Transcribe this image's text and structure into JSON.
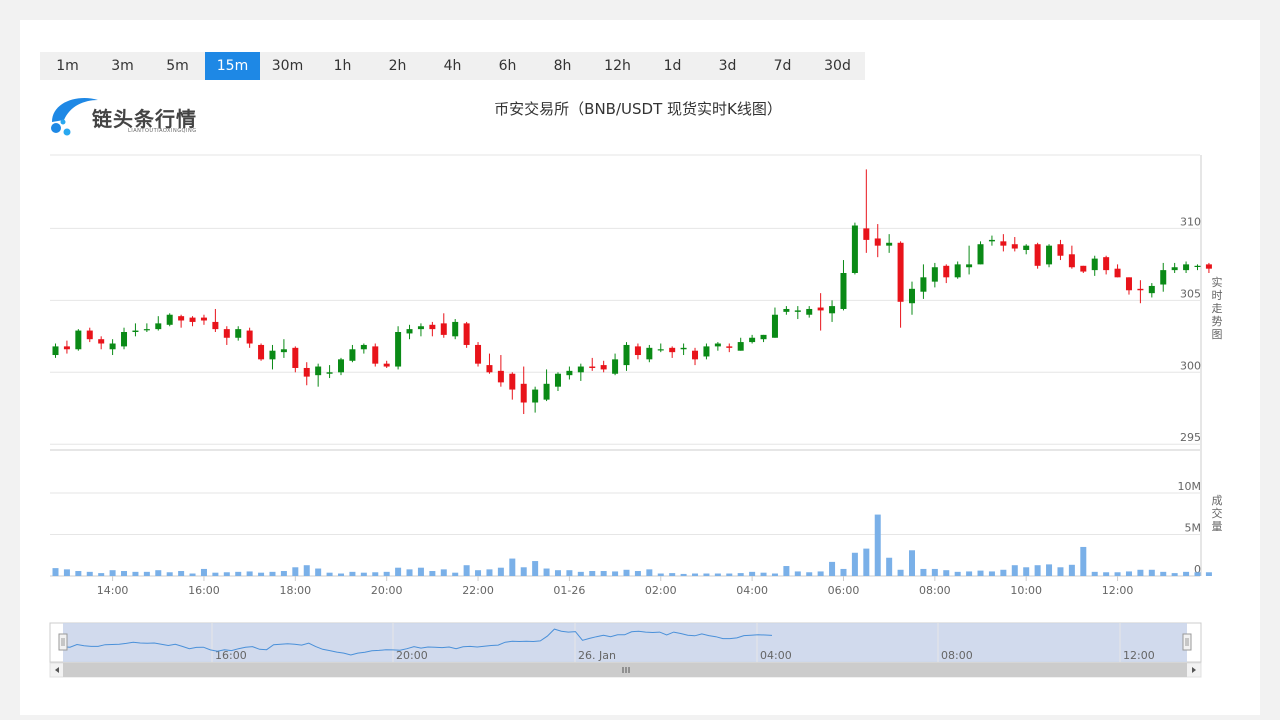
{
  "intervals": [
    "1m",
    "3m",
    "5m",
    "15m",
    "30m",
    "1h",
    "2h",
    "4h",
    "6h",
    "8h",
    "12h",
    "1d",
    "3d",
    "7d",
    "30d"
  ],
  "active_interval": "15m",
  "logo": {
    "text": "链头条行情",
    "subtext": "LIANTOUTIAOXINGQING"
  },
  "colors": {
    "up": "#0a8a16",
    "down": "#e8131a",
    "volume": "#7ab0e8",
    "accent": "#1e88e5"
  },
  "chart_data": {
    "type": "candlestick",
    "title": "币安交易所（BNB/USDT 现货实时K线图）",
    "price_axis": {
      "label": "实时走势图",
      "ticks": [
        295,
        300,
        305,
        310
      ],
      "range": [
        294.6,
        315.1
      ],
      "position": "right"
    },
    "volume_axis": {
      "label": "成交量",
      "ticks": [
        "0",
        "5M",
        "10M"
      ],
      "range": [
        0,
        10
      ],
      "unit": "M",
      "position": "right"
    },
    "x_ticks": [
      "14:00",
      "16:00",
      "18:00",
      "20:00",
      "22:00",
      "01-26",
      "02:00",
      "04:00",
      "06:00",
      "08:00",
      "10:00",
      "12:00"
    ],
    "interval_minutes": 15,
    "candles": [
      [
        301.2,
        301.8,
        302.0,
        301.0
      ],
      [
        301.8,
        301.6,
        302.2,
        301.3
      ],
      [
        301.6,
        302.9,
        303.0,
        301.5
      ],
      [
        302.9,
        302.3,
        303.1,
        302.1
      ],
      [
        302.3,
        302.0,
        302.5,
        301.6
      ],
      [
        301.6,
        302.0,
        302.3,
        301.2
      ],
      [
        301.8,
        302.8,
        303.1,
        301.6
      ],
      [
        302.8,
        302.9,
        303.4,
        302.5
      ],
      [
        303.0,
        303.0,
        303.4,
        302.8
      ],
      [
        303.0,
        303.4,
        303.9,
        302.9
      ],
      [
        303.3,
        304.0,
        304.1,
        303.2
      ],
      [
        303.9,
        303.6,
        304.0,
        303.1
      ],
      [
        303.8,
        303.5,
        303.9,
        303.2
      ],
      [
        303.8,
        303.6,
        304.0,
        303.3
      ],
      [
        303.5,
        303.0,
        304.4,
        302.8
      ],
      [
        303.0,
        302.4,
        303.2,
        301.9
      ],
      [
        302.4,
        303.0,
        303.2,
        302.2
      ],
      [
        302.9,
        302.0,
        303.1,
        301.7
      ],
      [
        301.9,
        300.9,
        302.0,
        300.8
      ],
      [
        300.9,
        301.5,
        301.9,
        300.2
      ],
      [
        301.4,
        301.6,
        302.3,
        301.0
      ],
      [
        301.7,
        300.3,
        301.8,
        300.0
      ],
      [
        300.3,
        299.7,
        300.7,
        299.1
      ],
      [
        299.8,
        300.4,
        300.6,
        299.0
      ],
      [
        299.9,
        300.0,
        300.5,
        299.6
      ],
      [
        300.0,
        300.9,
        301.0,
        299.8
      ],
      [
        300.8,
        301.6,
        301.9,
        300.7
      ],
      [
        301.6,
        301.9,
        302.0,
        301.3
      ],
      [
        301.8,
        300.6,
        302.0,
        300.4
      ],
      [
        300.6,
        300.4,
        300.8,
        300.3
      ],
      [
        300.4,
        302.8,
        303.2,
        300.2
      ],
      [
        302.7,
        303.0,
        303.3,
        302.3
      ],
      [
        303.0,
        303.2,
        303.4,
        302.5
      ],
      [
        303.3,
        303.0,
        303.5,
        302.5
      ],
      [
        303.4,
        302.6,
        304.1,
        302.4
      ],
      [
        302.5,
        303.5,
        303.7,
        302.3
      ],
      [
        303.4,
        301.9,
        303.5,
        301.7
      ],
      [
        301.9,
        300.6,
        302.1,
        300.4
      ],
      [
        300.5,
        300.0,
        301.3,
        299.9
      ],
      [
        300.1,
        299.3,
        301.2,
        299.0
      ],
      [
        299.9,
        298.8,
        300.0,
        298.1
      ],
      [
        299.2,
        297.9,
        300.4,
        297.1
      ],
      [
        297.9,
        298.8,
        299.0,
        297.2
      ],
      [
        298.1,
        299.2,
        300.2,
        298.0
      ],
      [
        299.0,
        299.9,
        300.0,
        298.7
      ],
      [
        299.8,
        300.1,
        300.4,
        299.5
      ],
      [
        300.0,
        300.4,
        300.6,
        299.4
      ],
      [
        300.4,
        300.3,
        301.0,
        300.1
      ],
      [
        300.5,
        300.2,
        300.8,
        300.0
      ],
      [
        299.9,
        300.9,
        301.3,
        299.8
      ],
      [
        300.5,
        301.9,
        302.1,
        300.1
      ],
      [
        301.8,
        301.2,
        302.0,
        300.9
      ],
      [
        300.9,
        301.7,
        301.9,
        300.7
      ],
      [
        301.6,
        301.6,
        302.0,
        301.4
      ],
      [
        301.7,
        301.4,
        301.8,
        301.0
      ],
      [
        301.6,
        301.7,
        302.0,
        301.2
      ],
      [
        301.5,
        300.9,
        301.7,
        300.5
      ],
      [
        301.1,
        301.8,
        302.0,
        300.9
      ],
      [
        301.8,
        302.0,
        302.1,
        301.5
      ],
      [
        301.8,
        301.7,
        302.0,
        301.4
      ],
      [
        301.5,
        302.1,
        302.4,
        301.5
      ],
      [
        302.1,
        302.4,
        302.6,
        302.0
      ],
      [
        302.3,
        302.6,
        302.6,
        302.1
      ],
      [
        302.4,
        304.0,
        304.5,
        302.4
      ],
      [
        304.2,
        304.4,
        304.6,
        304.0
      ],
      [
        304.2,
        304.3,
        304.6,
        303.7
      ],
      [
        304.0,
        304.4,
        304.6,
        303.8
      ],
      [
        304.5,
        304.3,
        305.5,
        302.9
      ],
      [
        304.1,
        304.6,
        305.0,
        303.5
      ],
      [
        304.4,
        306.9,
        307.8,
        304.3
      ],
      [
        306.9,
        310.2,
        310.4,
        306.8
      ],
      [
        310.0,
        309.2,
        314.1,
        308.3
      ],
      [
        309.3,
        308.8,
        310.3,
        308.0
      ],
      [
        308.8,
        309.0,
        309.6,
        308.3
      ],
      [
        309.0,
        304.9,
        309.1,
        303.1
      ],
      [
        304.8,
        305.8,
        306.3,
        304.0
      ],
      [
        305.6,
        306.6,
        307.5,
        305.1
      ],
      [
        306.3,
        307.3,
        307.6,
        305.9
      ],
      [
        307.4,
        306.6,
        307.5,
        306.2
      ],
      [
        306.6,
        307.5,
        307.7,
        306.5
      ],
      [
        307.3,
        307.5,
        308.8,
        306.8
      ],
      [
        307.5,
        308.9,
        309.1,
        307.5
      ],
      [
        309.1,
        309.2,
        309.5,
        308.8
      ],
      [
        309.1,
        308.8,
        309.6,
        308.4
      ],
      [
        308.9,
        308.6,
        309.4,
        308.4
      ],
      [
        308.5,
        308.8,
        308.9,
        308.2
      ],
      [
        308.9,
        307.4,
        309.0,
        307.2
      ],
      [
        307.5,
        308.8,
        308.9,
        307.3
      ],
      [
        308.9,
        308.1,
        309.2,
        307.8
      ],
      [
        308.2,
        307.3,
        308.8,
        307.2
      ],
      [
        307.4,
        307.0,
        307.4,
        306.9
      ],
      [
        307.1,
        307.9,
        308.1,
        306.7
      ],
      [
        308.0,
        307.1,
        308.1,
        306.8
      ],
      [
        307.2,
        306.6,
        307.5,
        306.6
      ],
      [
        306.6,
        305.7,
        306.6,
        305.4
      ],
      [
        305.8,
        305.7,
        306.4,
        304.8
      ],
      [
        305.5,
        306.0,
        306.2,
        305.2
      ],
      [
        306.1,
        307.1,
        307.6,
        305.6
      ],
      [
        307.1,
        307.3,
        307.6,
        306.9
      ],
      [
        307.1,
        307.5,
        307.7,
        306.9
      ],
      [
        307.4,
        307.4,
        307.5,
        307.1
      ],
      [
        307.5,
        307.2,
        307.6,
        306.9
      ]
    ],
    "volume_millions": [
      0.95,
      0.8,
      0.6,
      0.5,
      0.35,
      0.7,
      0.6,
      0.5,
      0.5,
      0.7,
      0.45,
      0.6,
      0.3,
      0.85,
      0.4,
      0.45,
      0.5,
      0.55,
      0.4,
      0.5,
      0.6,
      1.05,
      1.3,
      0.9,
      0.4,
      0.3,
      0.5,
      0.4,
      0.45,
      0.5,
      1.0,
      0.8,
      1.0,
      0.6,
      0.8,
      0.4,
      1.3,
      0.7,
      0.8,
      1.0,
      2.1,
      1.05,
      1.8,
      0.9,
      0.7,
      0.7,
      0.5,
      0.6,
      0.6,
      0.55,
      0.75,
      0.6,
      0.8,
      0.3,
      0.35,
      0.25,
      0.3,
      0.3,
      0.3,
      0.3,
      0.35,
      0.5,
      0.4,
      0.3,
      1.2,
      0.55,
      0.45,
      0.55,
      1.7,
      0.85,
      2.8,
      3.3,
      7.4,
      2.2,
      0.75,
      3.1,
      0.85,
      0.85,
      0.7,
      0.5,
      0.55,
      0.65,
      0.55,
      0.75,
      1.3,
      1.05,
      1.3,
      1.4,
      1.05,
      1.35,
      3.5,
      0.5,
      0.45,
      0.45,
      0.55,
      0.75,
      0.75,
      0.5,
      0.35,
      0.5,
      0.45,
      0.45
    ],
    "navigator": {
      "ticks": [
        "16:00",
        "20:00",
        "26. Jan",
        "04:00",
        "08:00",
        "12:00"
      ]
    }
  }
}
